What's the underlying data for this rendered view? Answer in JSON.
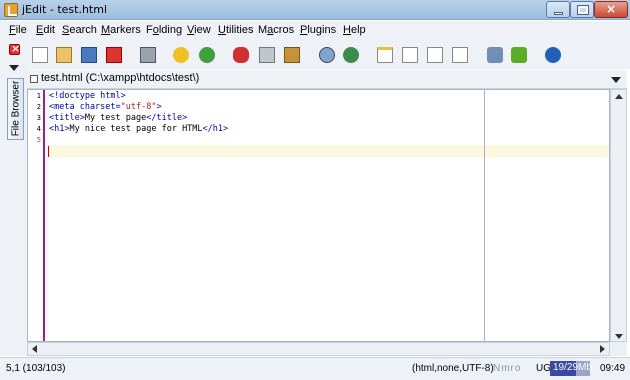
{
  "window": {
    "title": "jEdit - test.html",
    "close_glyph": "×"
  },
  "menu": {
    "items": [
      {
        "label": "File",
        "mnemonic": "F",
        "rest": "ile"
      },
      {
        "label": "Edit",
        "mnemonic": "E",
        "rest": "dit"
      },
      {
        "label": "Search",
        "mnemonic": "S",
        "rest": "earch"
      },
      {
        "label": "Markers",
        "mnemonic": "M",
        "rest": "arkers"
      },
      {
        "label": "Folding",
        "mnemonic": "o",
        "pre": "F",
        "rest": "lding"
      },
      {
        "label": "View",
        "mnemonic": "V",
        "rest": "iew"
      },
      {
        "label": "Utilities",
        "mnemonic": "U",
        "rest": "tilities"
      },
      {
        "label": "Macros",
        "mnemonic": "a",
        "pre": "M",
        "rest": "cros"
      },
      {
        "label": "Plugins",
        "mnemonic": "P",
        "rest": "lugins"
      },
      {
        "label": "Help",
        "mnemonic": "H",
        "rest": "elp"
      }
    ]
  },
  "toolbar": {
    "buttons": [
      "new-file-icon",
      "open-file-icon",
      "save-file-icon",
      "close-file-icon",
      "print-icon",
      "undo-icon",
      "redo-icon",
      "cut-icon",
      "copy-icon",
      "paste-icon",
      "find-icon",
      "find-replace-icon",
      "new-view-icon",
      "split-horizontal-icon",
      "split-vertical-icon",
      "unsplit-icon",
      "global-options-icon",
      "plugin-manager-icon",
      "help-icon"
    ]
  },
  "dock": {
    "tab_label": "File Browser"
  },
  "buffer": {
    "name": "test.html (C:\\xampp\\htdocs\\test\\)"
  },
  "editor": {
    "line_numbers": [
      "1",
      "2",
      "3",
      "4",
      "5"
    ],
    "current_line": 5,
    "lines": [
      [
        {
          "t": "tag",
          "v": "<!doctype html>"
        }
      ],
      [
        {
          "t": "tag",
          "v": "<meta charset="
        },
        {
          "t": "str",
          "v": "\"utf-8\""
        },
        {
          "t": "tag",
          "v": ">"
        }
      ],
      [
        {
          "t": "tag",
          "v": "<title>"
        },
        {
          "t": "txt",
          "v": "My test page"
        },
        {
          "t": "tag",
          "v": "</title>"
        }
      ],
      [
        {
          "t": "tag",
          "v": "<h1>"
        },
        {
          "t": "txt",
          "v": "My nice test page for HTML"
        },
        {
          "t": "tag",
          "v": "</h1>"
        }
      ],
      []
    ]
  },
  "status": {
    "caret_position": "5,1 (103/103)",
    "mode": "(html,none,UTF-8)",
    "flags": "Nmro",
    "encoding_short": "UG",
    "memory": "19/29Mb",
    "memory_used_fraction": 0.66,
    "clock": "09:49"
  },
  "colors": {
    "tag": "#0000aa",
    "string": "#a32020",
    "gutter_border": "#9b1d9b",
    "current_line": "#fbf8de"
  }
}
